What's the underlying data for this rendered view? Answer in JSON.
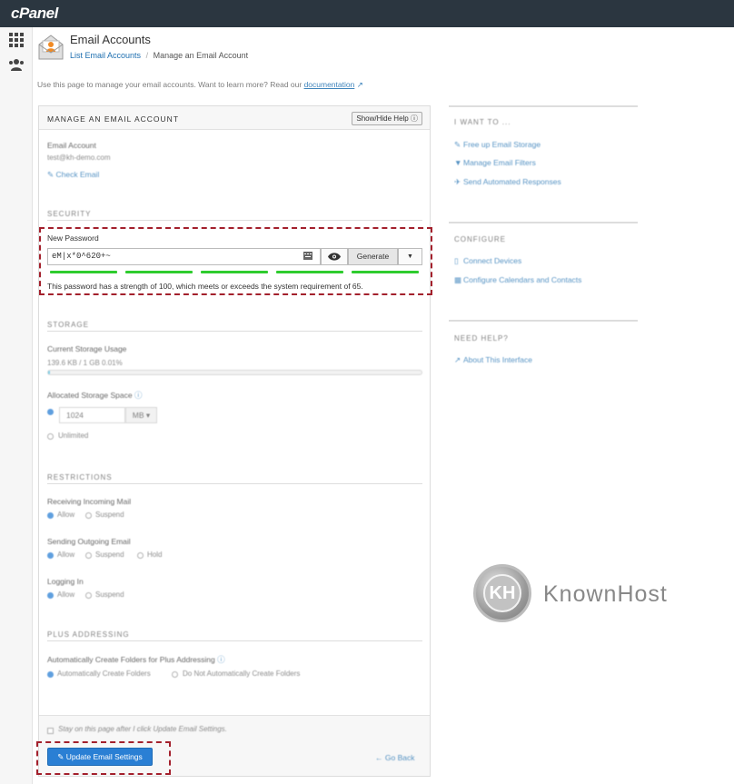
{
  "app": {
    "logo": "cPanel"
  },
  "header": {
    "title": "Email Accounts",
    "breadcrumb": {
      "link": "List Email Accounts",
      "separator": "/",
      "current": "Manage an Email Account"
    }
  },
  "intro": {
    "text": "Use this page to manage your email accounts. Want to learn more? Read our ",
    "link": "documentation"
  },
  "panel": {
    "title": "MANAGE AN EMAIL ACCOUNT",
    "help_button": "Show/Hide Help",
    "account": {
      "label": "Email Account",
      "value": "test@kh-demo.com",
      "check_link": "Check Email"
    },
    "security": {
      "heading": "SECURITY",
      "new_password_label": "New Password",
      "password_value": "eM|x*0^620+~",
      "generate_label": "Generate",
      "strength_text": "This password has a strength of 100, which meets or exceeds the system requirement of 65."
    },
    "storage": {
      "heading": "STORAGE",
      "usage_label": "Current Storage Usage",
      "usage_value": "139.6 KB / 1 GB 0.01%",
      "usage_percent": 0.01,
      "allocated_label": "Allocated Storage Space",
      "quota_value": "1024",
      "unit": "MB",
      "unlimited_label": "Unlimited"
    },
    "restrictions": {
      "heading": "RESTRICTIONS",
      "incoming_label": "Receiving Incoming Mail",
      "incoming_options": [
        "Allow",
        "Suspend"
      ],
      "outgoing_label": "Sending Outgoing Email",
      "outgoing_options": [
        "Allow",
        "Suspend",
        "Hold"
      ],
      "login_label": "Logging In",
      "login_options": [
        "Allow",
        "Suspend"
      ]
    },
    "plus": {
      "heading": "PLUS ADDRESSING",
      "label": "Automatically Create Folders for Plus Addressing",
      "options": [
        "Automatically Create Folders",
        "Do Not Automatically Create Folders"
      ]
    },
    "footer": {
      "stay_label": "Stay on this page after I click Update Email Settings.",
      "update_button": "Update Email Settings",
      "go_back": "Go Back"
    }
  },
  "right": {
    "want_to": {
      "heading": "I WANT TO ...",
      "links": [
        "Free up Email Storage",
        "Manage Email Filters",
        "Send Automated Responses"
      ]
    },
    "configure": {
      "heading": "CONFIGURE",
      "links": [
        "Connect Devices",
        "Configure Calendars and Contacts"
      ]
    },
    "need_help": {
      "heading": "NEED HELP?",
      "links": [
        "About This Interface"
      ]
    }
  },
  "watermark": {
    "text": "KnownHost",
    "logo_letters": "KH"
  },
  "colors": {
    "topbar": "#2b3640",
    "link": "#1e6fb0",
    "primary": "#2a7fd4",
    "strength": "#2ecc2e",
    "highlight": "#a3202c"
  }
}
